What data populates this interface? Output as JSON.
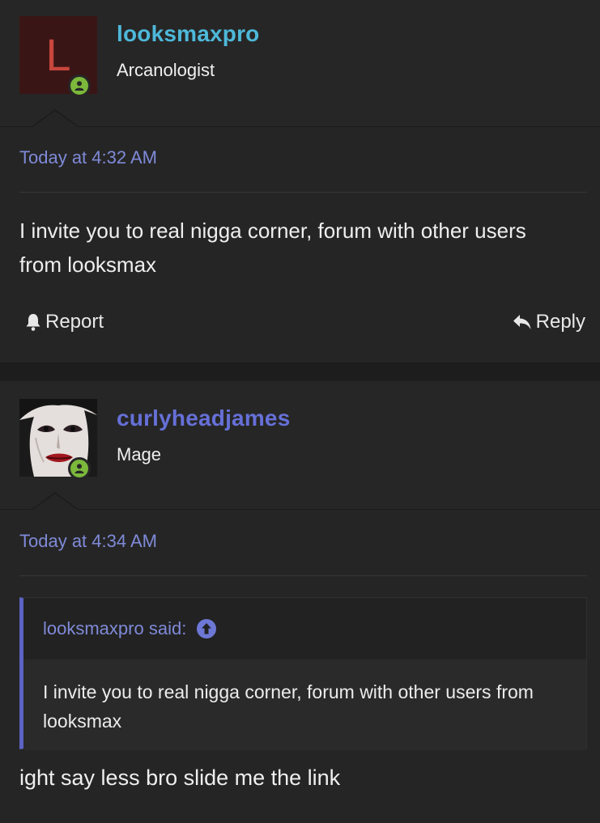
{
  "posts": [
    {
      "username": "looksmaxpro",
      "avatar_letter": "L",
      "user_title": "Arcanologist",
      "date": "Today at 4:32 AM",
      "body": "I invite you to real nigga corner, forum with other users from looksmax",
      "report_label": "Report",
      "reply_label": "Reply"
    },
    {
      "username": "curlyheadjames",
      "user_title": "Mage",
      "date": "Today at 4:34 AM",
      "quote": {
        "author_said": "looksmaxpro said:",
        "text": "I invite you to real nigga corner, forum with other users from looksmax"
      },
      "body": "ight say less bro slide me the link"
    }
  ],
  "colors": {
    "background": "#252525",
    "username_1": "#4eb8d9",
    "username_2": "#6670d8",
    "date": "#7f8ad8",
    "online": "#7cb83b",
    "quote_bar": "#5b63c4"
  },
  "icons": [
    "user-online-icon",
    "bell-icon",
    "reply-arrow-icon",
    "arrow-up-circle-icon"
  ]
}
